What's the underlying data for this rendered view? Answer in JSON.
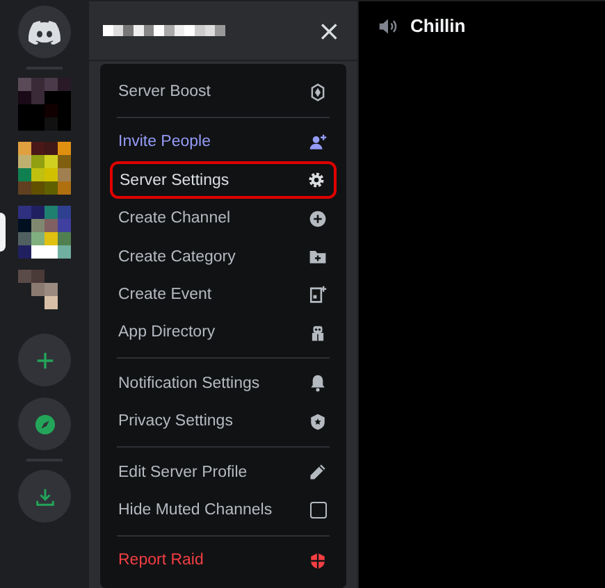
{
  "servers": [
    {
      "selected": false
    },
    {
      "selected": false
    },
    {
      "selected": true
    },
    {
      "selected": false
    }
  ],
  "panel": {
    "close": "×"
  },
  "menu": {
    "groups": [
      [
        {
          "label": "Server Boost",
          "kind": "normal",
          "outlined": false
        }
      ],
      [
        {
          "label": "Invite People",
          "kind": "invite",
          "outlined": false
        },
        {
          "label": "Server Settings",
          "kind": "normal",
          "outlined": true
        },
        {
          "label": "Create Channel",
          "kind": "normal",
          "outlined": false
        },
        {
          "label": "Create Category",
          "kind": "normal",
          "outlined": false
        },
        {
          "label": "Create Event",
          "kind": "normal",
          "outlined": false
        },
        {
          "label": "App Directory",
          "kind": "normal",
          "outlined": false
        }
      ],
      [
        {
          "label": "Notification Settings",
          "kind": "normal",
          "outlined": false
        },
        {
          "label": "Privacy Settings",
          "kind": "normal",
          "outlined": false
        }
      ],
      [
        {
          "label": "Edit Server Profile",
          "kind": "normal",
          "outlined": false
        },
        {
          "label": "Hide Muted Channels",
          "kind": "checkbox",
          "checked": false,
          "outlined": false
        }
      ],
      [
        {
          "label": "Report Raid",
          "kind": "danger",
          "outlined": false
        }
      ]
    ]
  },
  "channel": {
    "name": "Chillin"
  }
}
